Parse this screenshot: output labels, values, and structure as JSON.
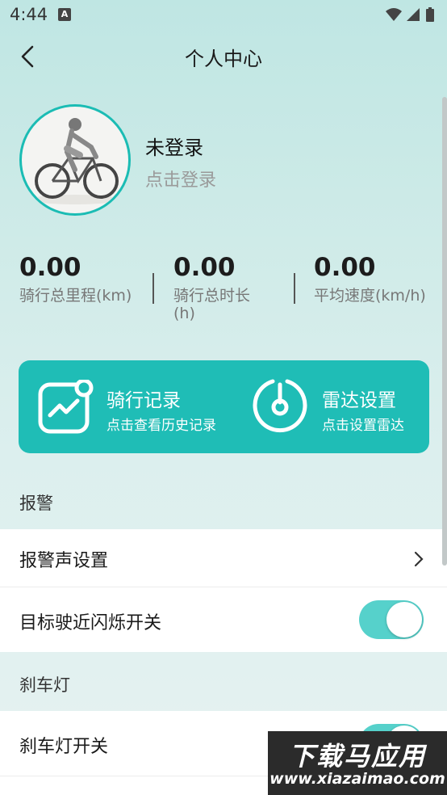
{
  "status_bar": {
    "time": "4:44",
    "app_icon": "A"
  },
  "header": {
    "title": "个人中心"
  },
  "profile": {
    "name": "未登录",
    "login_hint": "点击登录"
  },
  "stats": [
    {
      "value": "0.00",
      "label": "骑行总里程(km)"
    },
    {
      "value": "0.00",
      "label": "骑行总时长(h)"
    },
    {
      "value": "0.00",
      "label": "平均速度(km/h)"
    }
  ],
  "actions": [
    {
      "title": "骑行记录",
      "subtitle": "点击查看历史记录",
      "icon": "chart-icon"
    },
    {
      "title": "雷达设置",
      "subtitle": "点击设置雷达",
      "icon": "gauge-icon"
    }
  ],
  "sections": [
    {
      "header": "报警",
      "rows": [
        {
          "label": "报警声设置",
          "type": "chevron"
        },
        {
          "label": "目标驶近闪烁开关",
          "type": "toggle",
          "on": true
        }
      ]
    },
    {
      "header": "刹车灯",
      "rows": [
        {
          "label": "刹车灯开关",
          "type": "toggle",
          "on": true
        }
      ]
    }
  ],
  "watermark": {
    "title": "下载马应用",
    "url": "www.xiazaimao.com"
  },
  "colors": {
    "accent": "#1fbdb6",
    "toggle_on": "#56d1cb"
  }
}
